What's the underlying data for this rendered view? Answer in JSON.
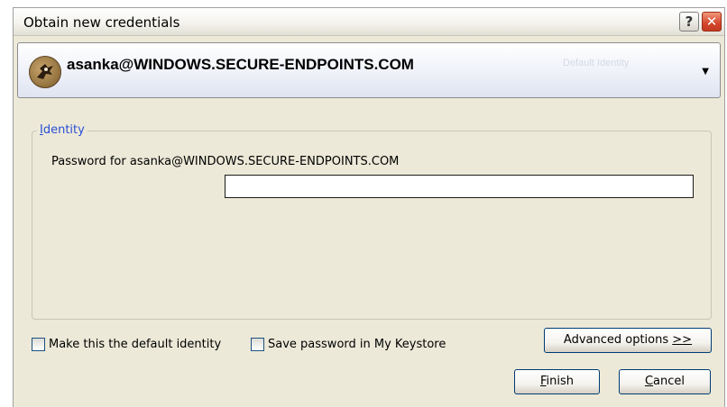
{
  "window": {
    "title": "Obtain new credentials",
    "help_glyph": "?",
    "close_glyph": "✕"
  },
  "identity_selector": {
    "name": "asanka@WINDOWS.SECURE-ENDPOINTS.COM",
    "faint_text": "Default Identity",
    "avatar_icon": "identity-icon",
    "arrow_icon": "chevron-down-icon"
  },
  "identity_group": {
    "legend_first": "I",
    "legend_rest": "dentity",
    "password_label": "Password for asanka@WINDOWS.SECURE-ENDPOINTS.COM",
    "password_value": ""
  },
  "options": {
    "default_identity_label": "Make this the default identity",
    "save_password_label": "Save password in My Keystore",
    "default_identity_checked": false,
    "save_password_checked": false
  },
  "buttons": {
    "advanced_pre": "Advanced options ",
    "advanced_mnemonic": ">",
    "advanced_post": ">",
    "finish_mnemonic": "F",
    "finish_rest": "inish",
    "cancel_mnemonic": "C",
    "cancel_rest": "ancel"
  },
  "colors": {
    "dialog_bg": "#ece9d8",
    "legend_blue": "#2a4fd5",
    "close_red": "#d4462b"
  }
}
